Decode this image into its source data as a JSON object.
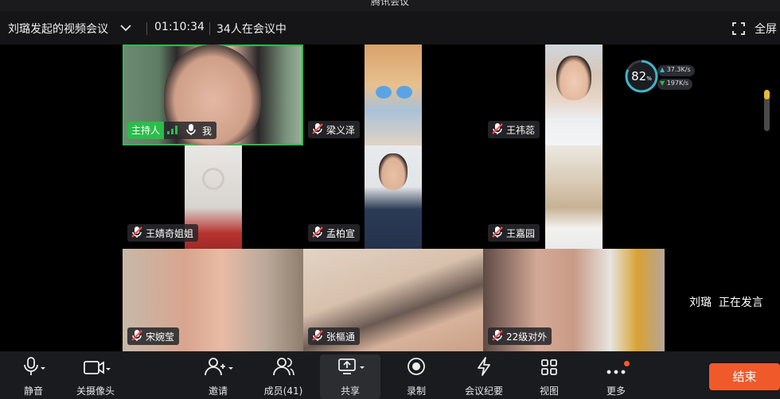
{
  "window": {
    "title": "腾讯会议"
  },
  "topbar": {
    "meeting_title": "刘璐发起的视频会议",
    "timer": "01:10:34",
    "participants_count": "34人在会议中",
    "fullscreen_label": "全屏"
  },
  "network": {
    "cpu_percent": "82",
    "percent_sign": "%",
    "upload": "37.3",
    "upload_unit": "K/s",
    "download": "197",
    "download_unit": "K/s"
  },
  "tiles": [
    {
      "name": "我",
      "host_badge": "主持人",
      "mic": "on",
      "is_host": true
    },
    {
      "name": "梁义泽",
      "mic": "muted"
    },
    {
      "name": "王祎蕊",
      "mic": "muted"
    },
    {
      "name": "王婧奇姐姐",
      "mic": "muted"
    },
    {
      "name": "孟柏宣",
      "mic": "muted"
    },
    {
      "name": "王嘉园",
      "mic": "muted"
    },
    {
      "name": "宋婉莹",
      "mic": "muted"
    },
    {
      "name": "张樞通",
      "mic": "muted"
    },
    {
      "name": "22级对外",
      "mic": "muted"
    }
  ],
  "speaking": {
    "speaker": "刘璐",
    "status": "正在发言"
  },
  "toolbar": {
    "mute": "静音",
    "camera": "关摄像头",
    "invite": "邀请",
    "members": "成员(41)",
    "share": "共享",
    "record": "录制",
    "summary": "会议纪要",
    "view": "视图",
    "more": "更多",
    "end": "结束"
  },
  "colors": {
    "accent_green": "#2bbd4a",
    "end_button": "#f05a2b",
    "notification_dot": "#ff5a2a"
  }
}
